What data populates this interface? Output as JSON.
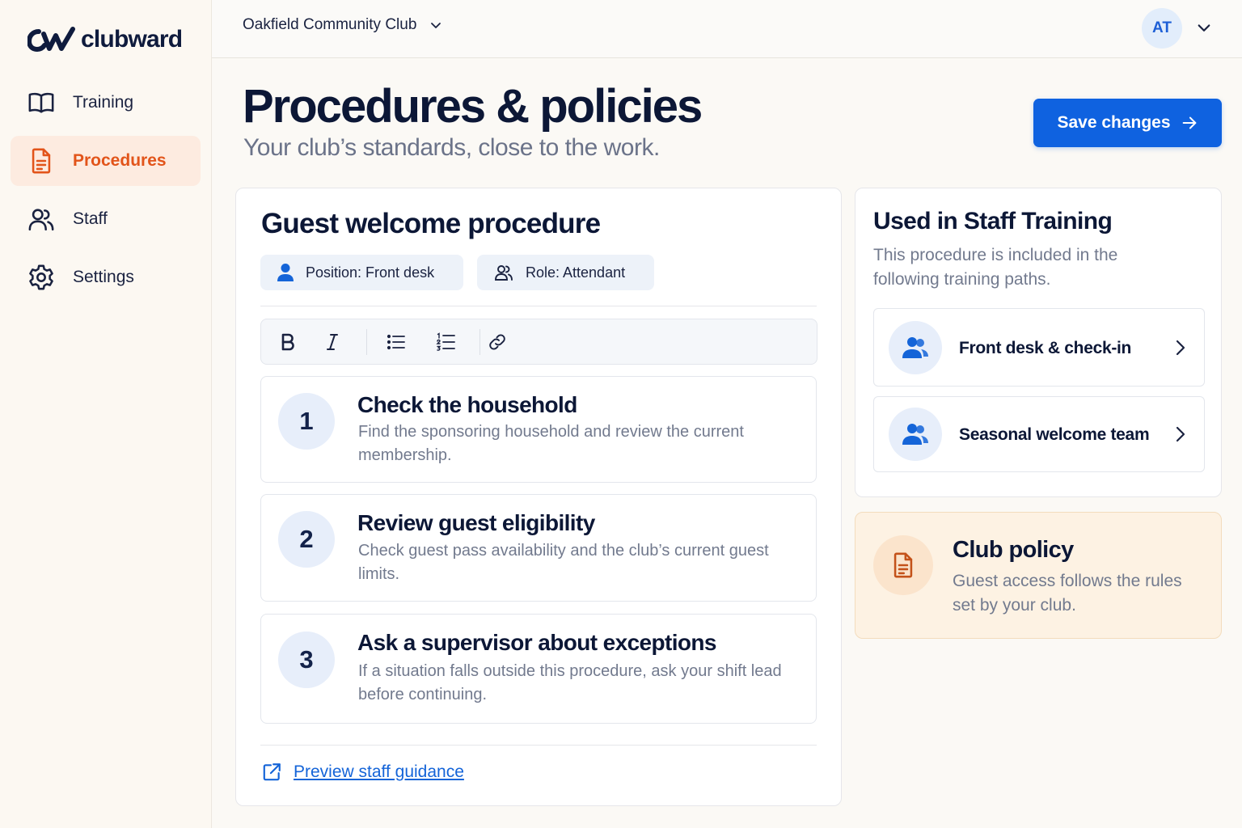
{
  "brand": {
    "name": "clubward",
    "accent": "#e2541a",
    "primary": "#0f62e0"
  },
  "sidebar": {
    "items": [
      {
        "label": "Training",
        "icon": "book-icon",
        "active": false
      },
      {
        "label": "Procedures",
        "icon": "document-icon",
        "active": true
      },
      {
        "label": "Staff",
        "icon": "users-icon",
        "active": false
      },
      {
        "label": "Settings",
        "icon": "gear-icon",
        "active": false
      }
    ]
  },
  "topbar": {
    "club_name": "Oakfield Community Club",
    "avatar_initials": "AT"
  },
  "header": {
    "title": "Procedures & policies",
    "subtitle": "Your club’s standards, close to the work.",
    "save_label": "Save changes"
  },
  "procedure": {
    "title": "Guest welcome procedure",
    "position_chip": "Position: Front desk",
    "role_chip": "Role: Attendant",
    "toolbar": [
      "bold",
      "italic",
      "bulleted-list",
      "numbered-list",
      "link"
    ],
    "steps": [
      {
        "number": "1",
        "title": "Check the household",
        "description": "Find the sponsoring household and review the current membership."
      },
      {
        "number": "2",
        "title": "Review guest eligibility",
        "description": "Check guest pass availability and the club’s current guest limits."
      },
      {
        "number": "3",
        "title": "Ask a supervisor about exceptions",
        "description": "If a situation falls outside this procedure, ask your shift lead before continuing."
      }
    ],
    "preview_link": "Preview staff guidance"
  },
  "training": {
    "title": "Used in Staff Training",
    "description": "This procedure is included in the following training paths.",
    "paths": [
      {
        "label": "Front desk & check-in"
      },
      {
        "label": "Seasonal welcome team"
      }
    ]
  },
  "policy": {
    "title": "Club policy",
    "description": "Guest access follows the rules set by your club."
  }
}
